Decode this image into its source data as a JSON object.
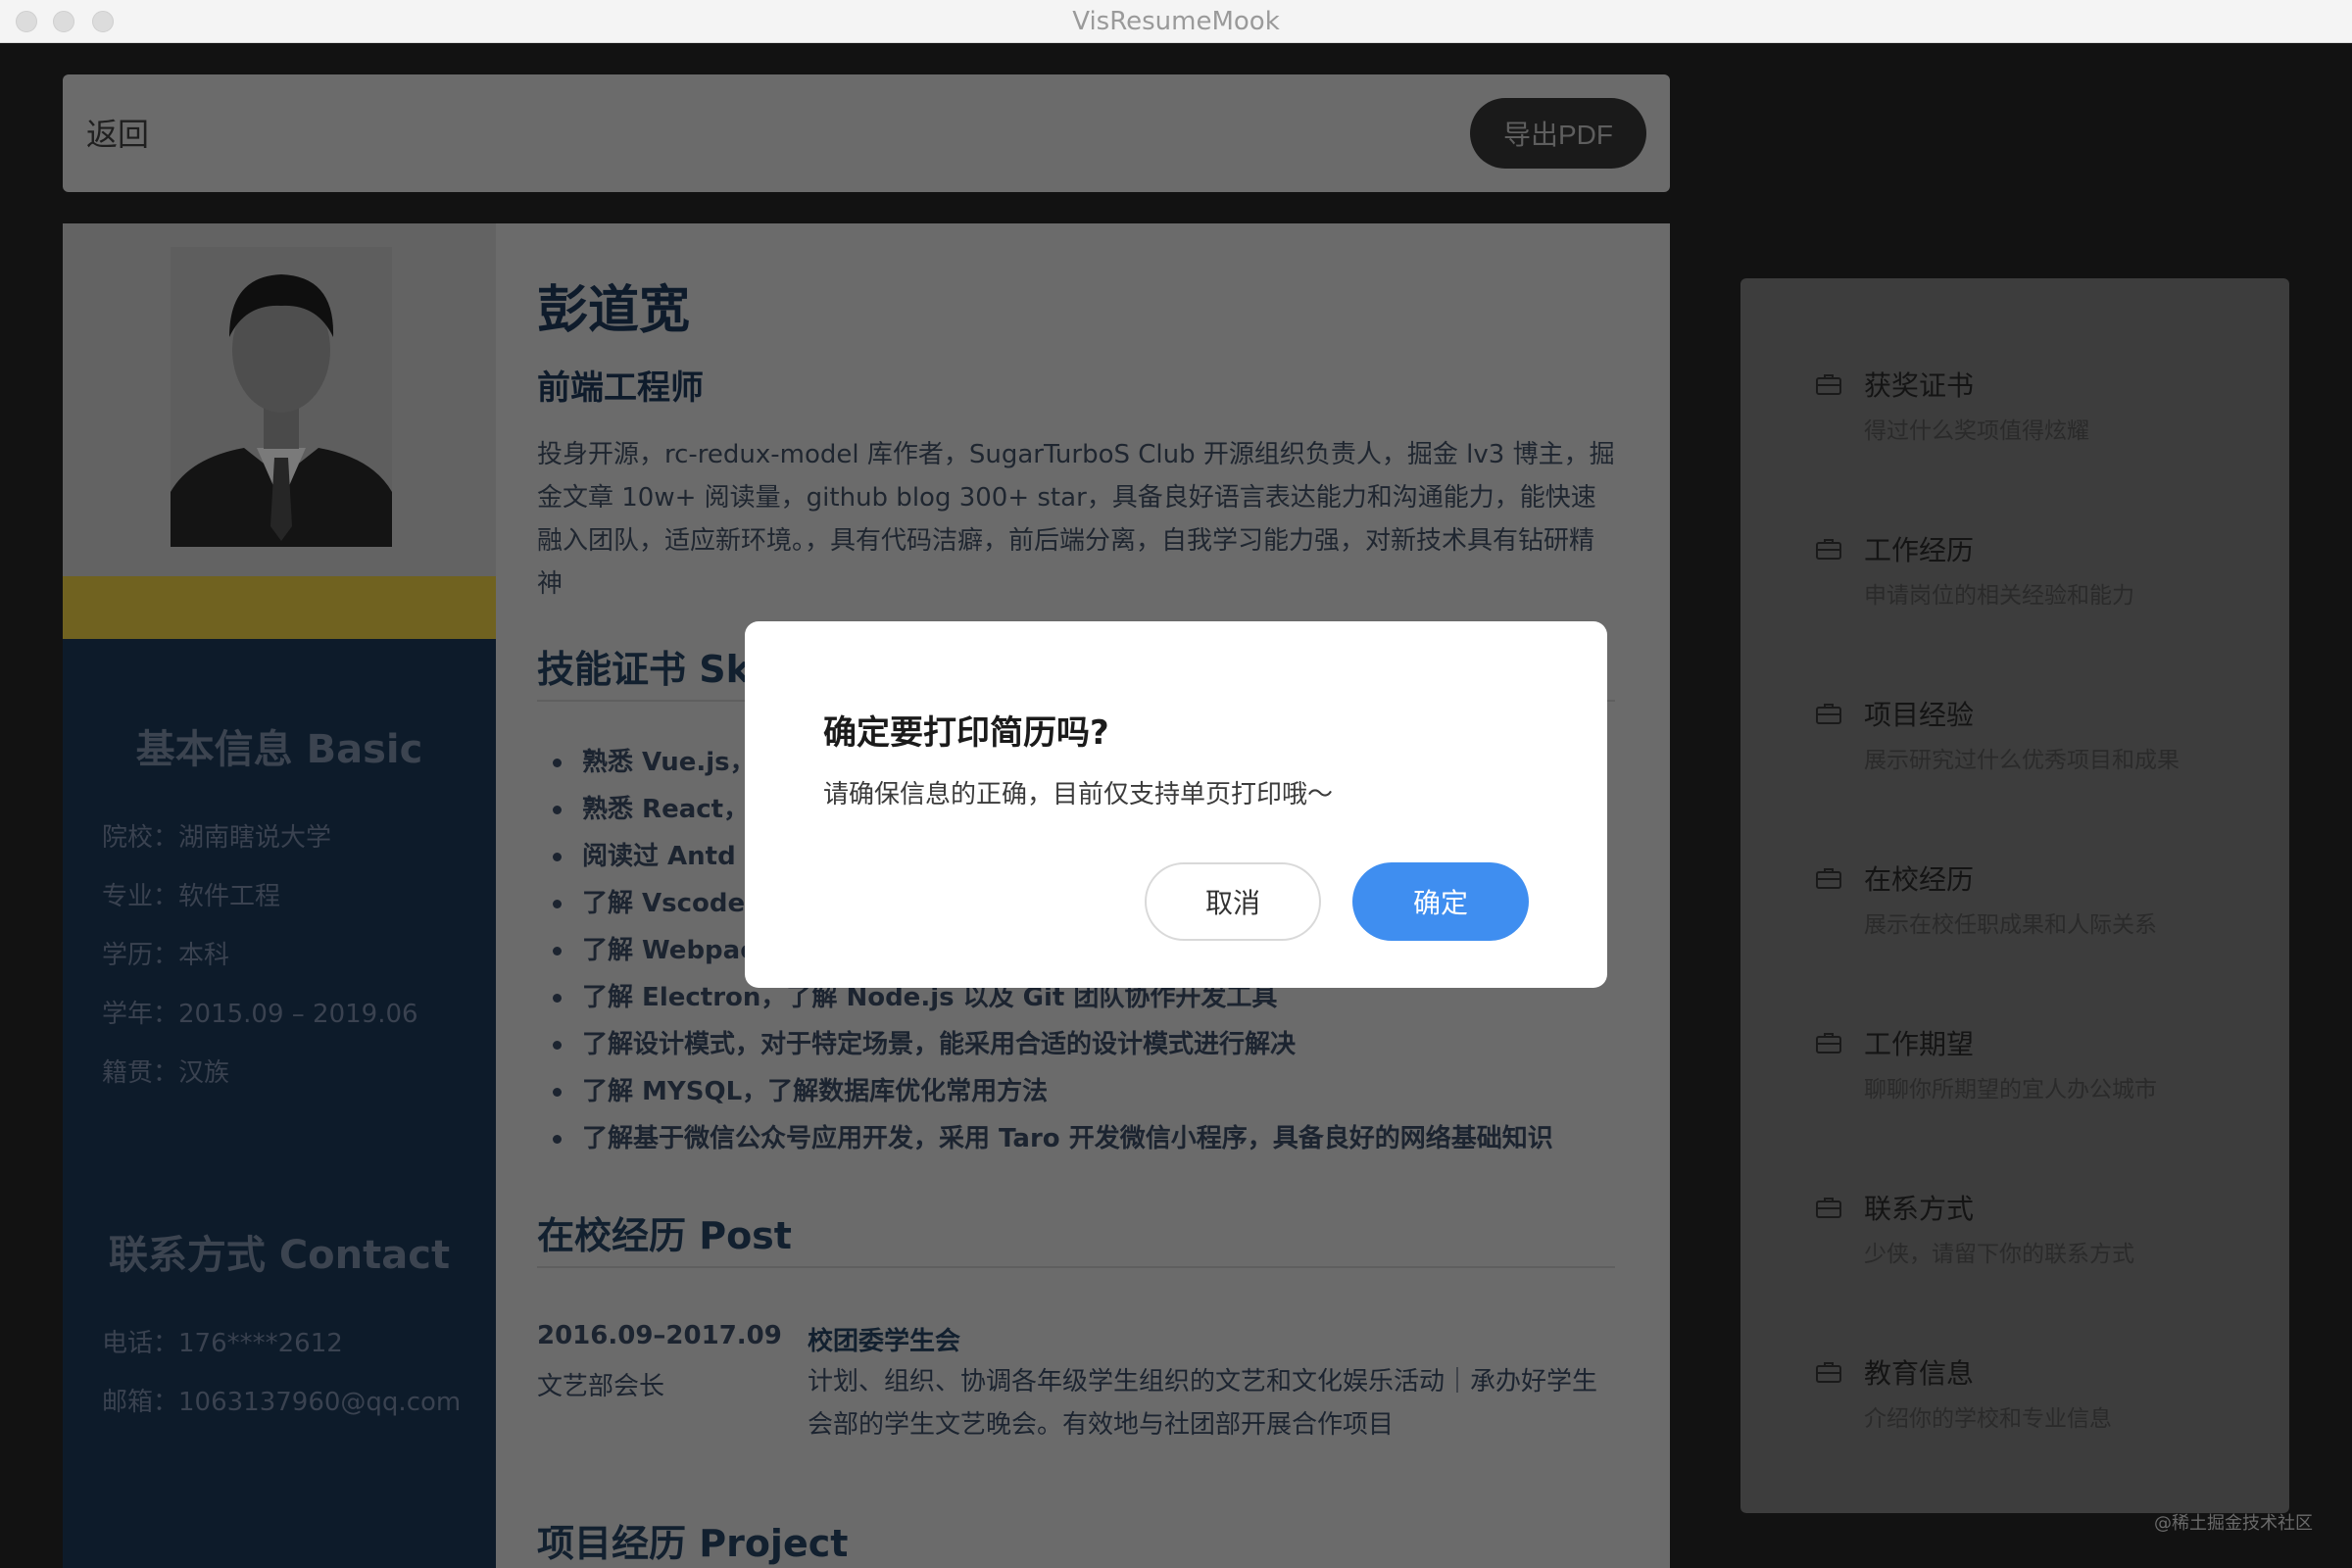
{
  "window": {
    "title": "VisResumeMook"
  },
  "toolbar": {
    "back_label": "返回",
    "export_label": "导出PDF"
  },
  "resume": {
    "name": "彭道宽",
    "role": "前端工程师",
    "intro": "投身开源，rc-redux-model 库作者，SugarTurboS Club 开源组织负责人，掘金 lv3 博主，掘金文章 10w+ 阅读量，github blog 300+ star，具备良好语言表达能力和沟通能力，能快速融入团队，适应新环境。，具有代码洁癖，前后端分离，自我学习能力强，对新技术具有钻研精神",
    "sidebar": {
      "basic_title": "基本信息 Basic",
      "basic": [
        "院校：湖南瞎说大学",
        "专业：软件工程",
        "学历：本科",
        "学年：2015.09 – 2019.06",
        "籍贯：汉族"
      ],
      "contact_title": "联系方式 Contact",
      "contact": [
        "电话：176****2612",
        "邮箱：1063137960@qq.com"
      ]
    },
    "skills_title": "技能证书 Sk",
    "skills": [
      "熟悉 Vue.js，",
      "熟悉 React，",
      "阅读过 Antd 部",
      "了解 Vscode，",
      "了解 Webpac",
      "了解 Electron，了解 Node.js 以及 Git 团队协作开发工具",
      "了解设计模式，对于特定场景，能采用合适的设计模式进行解决",
      "了解 MYSQL，了解数据库优化常用方法",
      "了解基于微信公众号应用开发，采用 Taro 开发微信小程序，具备良好的网络基础知识"
    ],
    "post_title": "在校经历 Post",
    "post": {
      "date": "2016.09–2017.09",
      "org": "校团委学生会",
      "role": "文艺部会长",
      "desc": "计划、组织、协调各年级学生组织的文艺和文化娱乐活动｜承办好学生会部的学生文艺晚会。有效地与社团部开展合作项目"
    },
    "project_title": "项目经历 Project"
  },
  "modules": [
    {
      "title": "获奖证书",
      "subtitle": "得过什么奖项值得炫耀",
      "icon": "briefcase-icon"
    },
    {
      "title": "工作经历",
      "subtitle": "申请岗位的相关经验和能力",
      "icon": "briefcase-icon"
    },
    {
      "title": "项目经验",
      "subtitle": "展示研究过什么优秀项目和成果",
      "icon": "briefcase-icon"
    },
    {
      "title": "在校经历",
      "subtitle": "展示在校任职成果和人际关系",
      "icon": "briefcase-icon"
    },
    {
      "title": "工作期望",
      "subtitle": "聊聊你所期望的宜人办公城市",
      "icon": "briefcase-icon"
    },
    {
      "title": "联系方式",
      "subtitle": "少侠，请留下你的联系方式",
      "icon": "briefcase-icon"
    },
    {
      "title": "教育信息",
      "subtitle": "介绍你的学校和专业信息",
      "icon": "briefcase-icon"
    }
  ],
  "watermark": "@稀土掘金技术社区",
  "dialog": {
    "title": "确定要打印简历吗?",
    "message": "请确保信息的正确，目前仅支持单页打印哦～",
    "cancel_label": "取消",
    "ok_label": "确定"
  },
  "colors": {
    "accent": "#3f8ef0",
    "sidebar": "#0d1b2a",
    "accent_bar": "#706220"
  }
}
